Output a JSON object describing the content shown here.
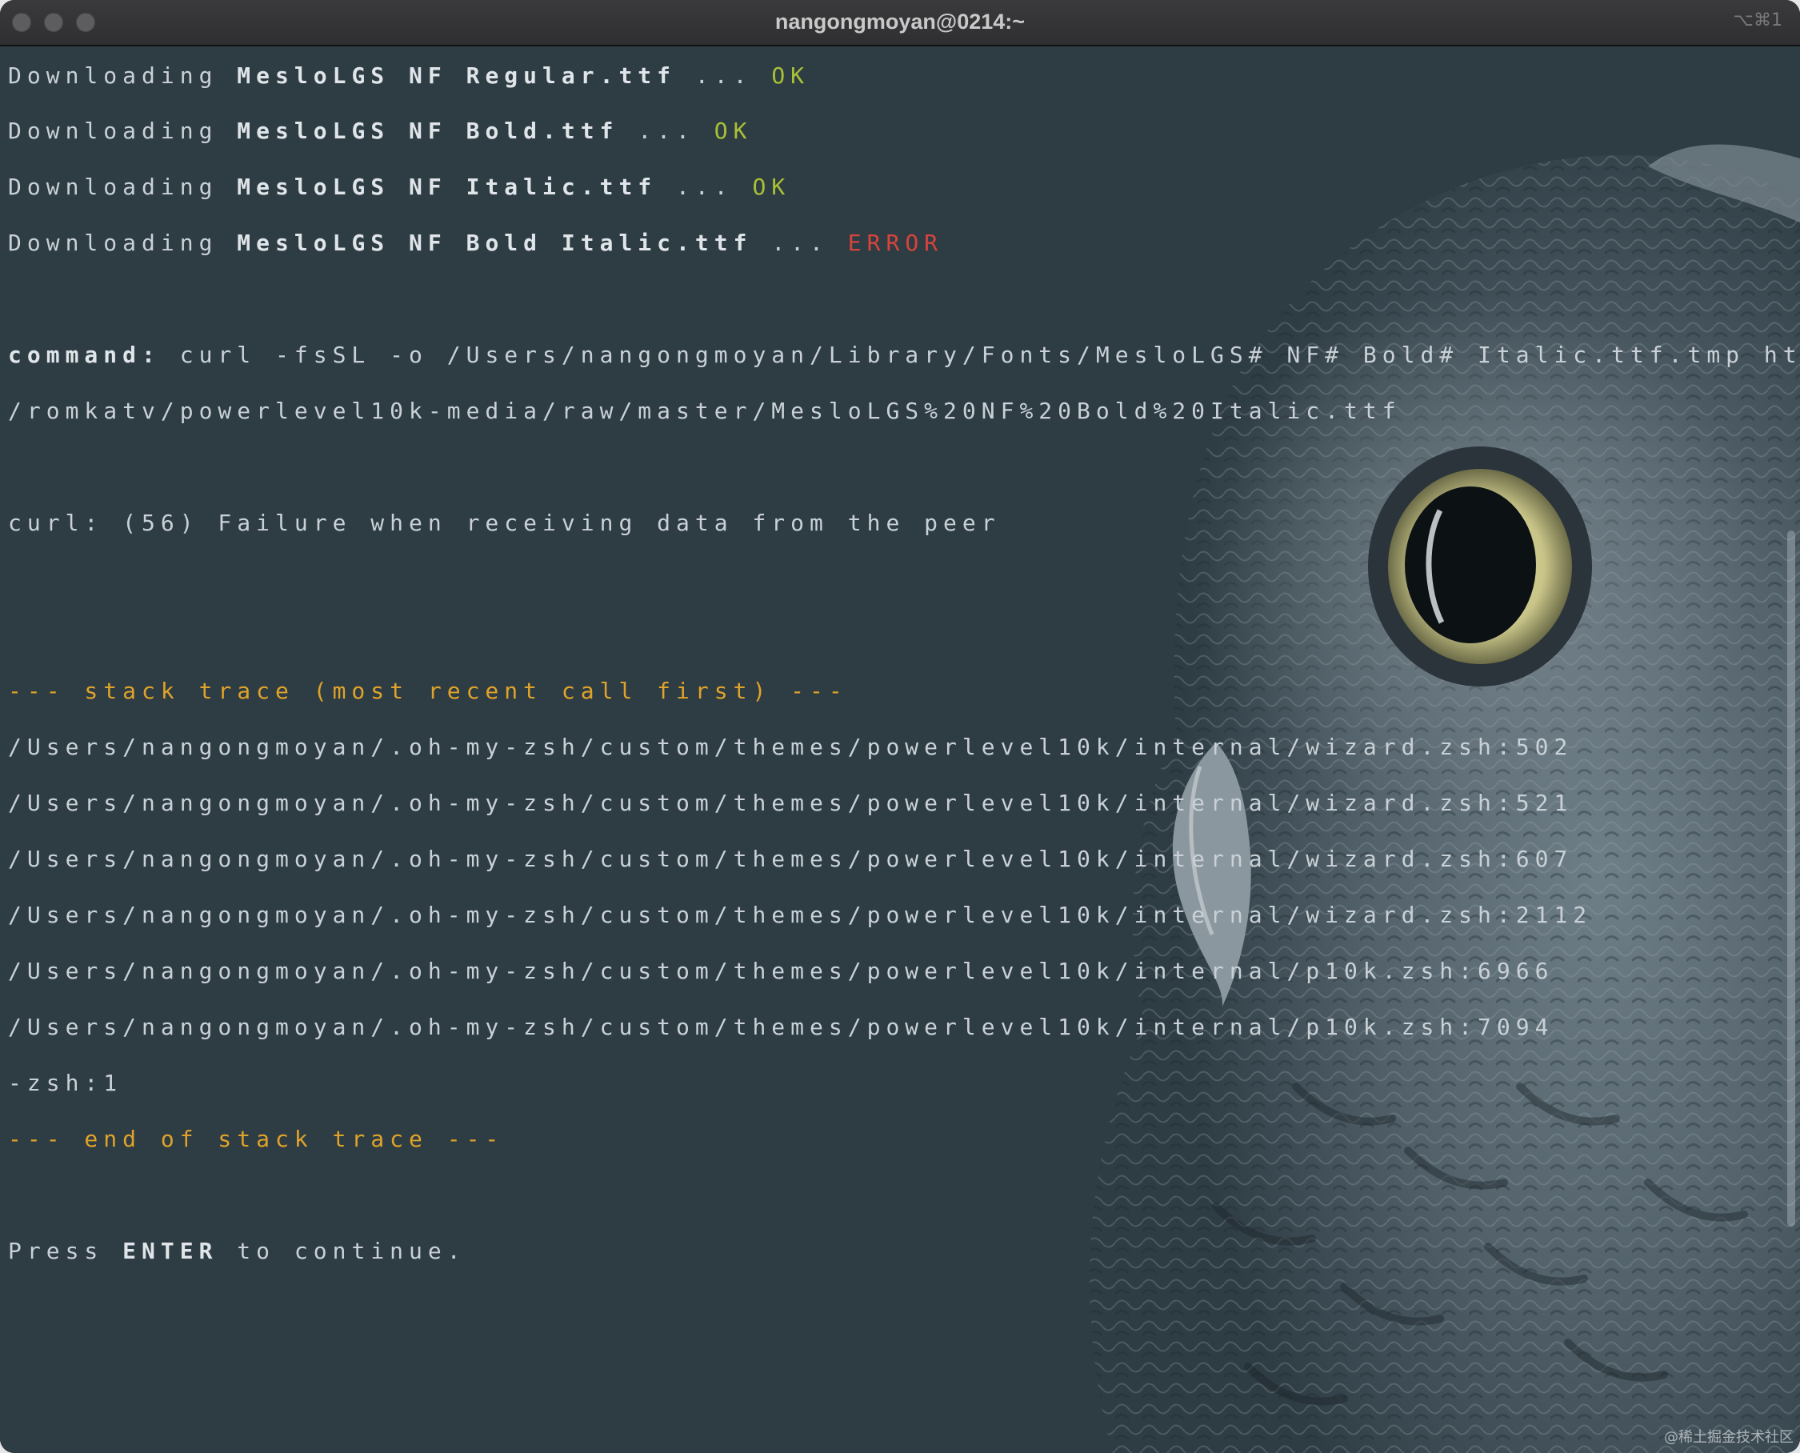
{
  "window": {
    "title": "nangongmoyan@0214:~",
    "shortcut": "⌥⌘1"
  },
  "terminal": {
    "downloads": [
      {
        "prefix": "Downloading",
        "file": "MesloLGS NF Regular.ttf",
        "dots": "...",
        "status": "OK"
      },
      {
        "prefix": "Downloading",
        "file": "MesloLGS NF Bold.ttf",
        "dots": "...",
        "status": "OK"
      },
      {
        "prefix": "Downloading",
        "file": "MesloLGS NF Italic.ttf",
        "dots": "...",
        "status": "OK"
      },
      {
        "prefix": "Downloading",
        "file": "MesloLGS NF Bold Italic.ttf",
        "dots": "...",
        "status": "ERROR"
      }
    ],
    "command_label": "command:",
    "command_line1": "curl -fsSL -o /Users/nangongmoyan/Library/Fonts/MesloLGS# NF# Bold# Italic.ttf.tmp https://github.com",
    "command_line2": "/romkatv/powerlevel10k-media/raw/master/MesloLGS%20NF%20Bold%20Italic.ttf",
    "curl_error": "curl: (56) Failure when receiving data from the peer",
    "stack_header": "--- stack trace (most recent call first) ---",
    "stack_lines": [
      "/Users/nangongmoyan/.oh-my-zsh/custom/themes/powerlevel10k/internal/wizard.zsh:502",
      "/Users/nangongmoyan/.oh-my-zsh/custom/themes/powerlevel10k/internal/wizard.zsh:521",
      "/Users/nangongmoyan/.oh-my-zsh/custom/themes/powerlevel10k/internal/wizard.zsh:607",
      "/Users/nangongmoyan/.oh-my-zsh/custom/themes/powerlevel10k/internal/wizard.zsh:2112",
      "/Users/nangongmoyan/.oh-my-zsh/custom/themes/powerlevel10k/internal/p10k.zsh:6966",
      "/Users/nangongmoyan/.oh-my-zsh/custom/themes/powerlevel10k/internal/p10k.zsh:7094",
      "-zsh:1"
    ],
    "stack_footer": "--- end of stack trace ---",
    "prompt_before": "Press ",
    "prompt_key": "ENTER",
    "prompt_after": " to continue."
  },
  "watermark": "@稀土掘金技术社区",
  "colors": {
    "background": "#2e3c44",
    "ok": "#a9c135",
    "error": "#d8443c",
    "stack_header": "#e0a329",
    "text": "#c9d1d6"
  },
  "background_image": "owl-icon"
}
